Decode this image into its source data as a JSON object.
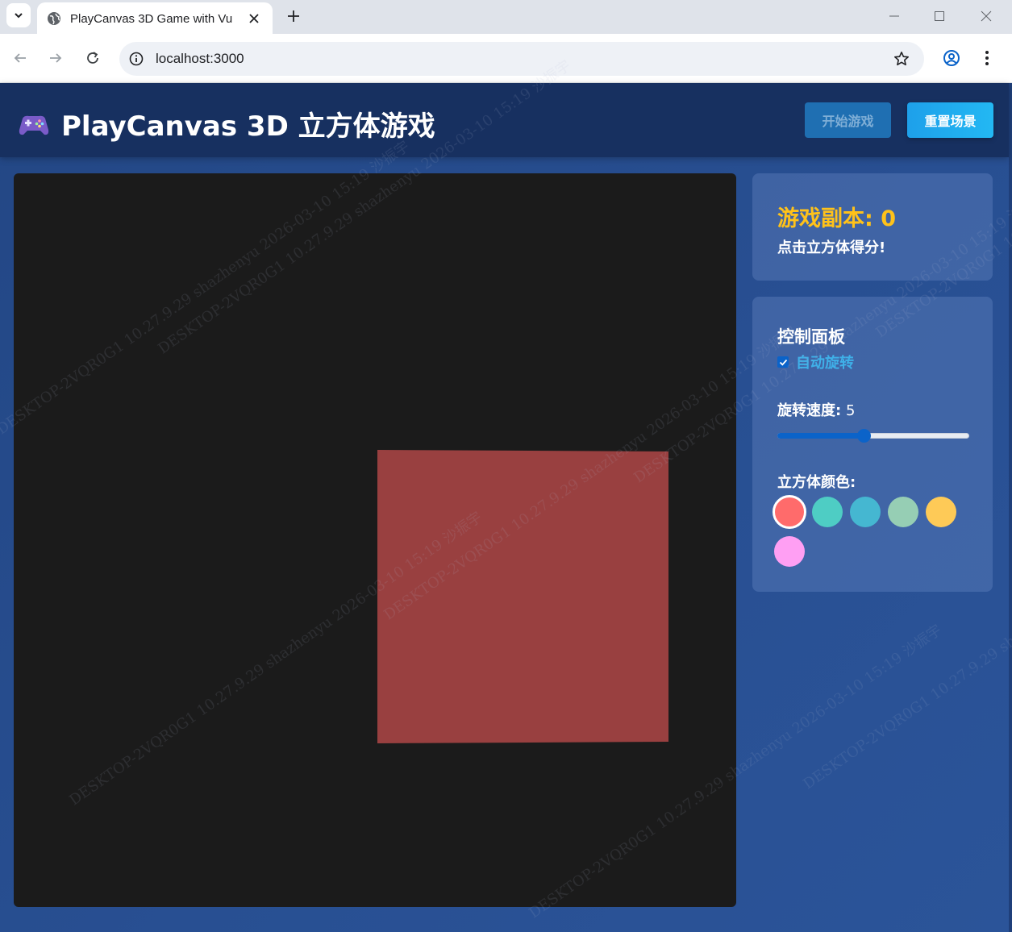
{
  "browser": {
    "tab_title": "PlayCanvas 3D Game with Vu",
    "url": "localhost:3000"
  },
  "app": {
    "title": "PlayCanvas 3D 立方体游戏",
    "logo_icon": "gamepad-icon",
    "buttons": {
      "start": "开始游戏",
      "reset": "重置场景"
    }
  },
  "scene": {
    "background_color": "#1b1b1b",
    "cube_color": "#994040"
  },
  "score": {
    "label": "游戏副本: 0",
    "hint": "点击立方体得分!"
  },
  "controls": {
    "title": "控制面板",
    "auto_rotate_label": "自动旋转",
    "auto_rotate_checked": true,
    "speed_label": "旋转速度:",
    "speed_value": "5",
    "speed_fraction": 0.45,
    "color_label": "立方体颜色:",
    "colors": [
      "#ff6b6b",
      "#4ecdc4",
      "#45b7d1",
      "#96ceb4",
      "#feca57",
      "#ff9ff3"
    ],
    "selected_color_index": 0
  },
  "watermark": {
    "text": "DESKTOP-2VQR0G1 10.27.9.29 shazhenyu 2026-03-10 15:19 沙振宇"
  }
}
